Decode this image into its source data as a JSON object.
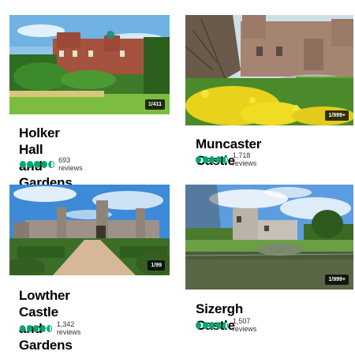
{
  "accent_color": "#00aa6c",
  "attractions": [
    {
      "title_line1": "Holker Hall",
      "title_line2": "and Gardens",
      "rating": 4.5,
      "reviews": "693 reviews",
      "photo_count": "1/411",
      "image_icon": "holker-hall-photo"
    },
    {
      "title_line1": "Muncaster Castle",
      "title_line2": "",
      "rating": 4.5,
      "reviews": "1,718 reviews",
      "photo_count": "1/999+",
      "image_icon": "muncaster-castle-photo"
    },
    {
      "title_line1": "Lowther Castle",
      "title_line2": "and Gardens",
      "rating": 4.5,
      "reviews": "1,342 reviews",
      "photo_count": "1/99",
      "image_icon": "lowther-castle-photo"
    },
    {
      "title_line1": "Sizergh Castle",
      "title_line2": "",
      "rating": 4.5,
      "reviews": "1,507 reviews",
      "photo_count": "1/999+",
      "image_icon": "sizergh-castle-photo"
    }
  ]
}
